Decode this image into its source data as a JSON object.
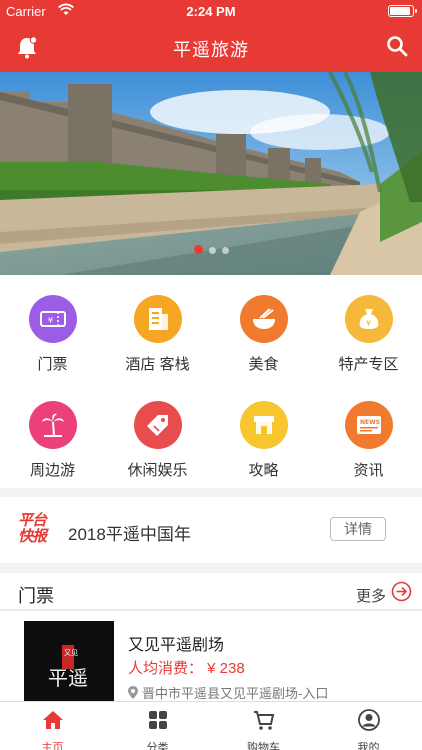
{
  "status": {
    "carrier": "Carrier",
    "time": "2:24 PM"
  },
  "nav": {
    "title": "平遥旅游",
    "bell_icon": "bell-icon",
    "search_icon": "search-icon"
  },
  "banner": {
    "page_count": 3,
    "active_index": 0
  },
  "categories": [
    {
      "label": "门票",
      "icon": "ticket-icon",
      "color": "#9b5de5"
    },
    {
      "label": "酒店 客栈",
      "icon": "hotel-icon",
      "color": "#f5a623"
    },
    {
      "label": "美食",
      "icon": "bowl-icon",
      "color": "#f07a2e"
    },
    {
      "label": "特产专区",
      "icon": "bag-icon",
      "color": "#f6b83a"
    },
    {
      "label": "周边游",
      "icon": "palm-tree-icon",
      "color": "#ec407a"
    },
    {
      "label": "休闲娱乐",
      "icon": "tag-icon",
      "color": "#e84d4d"
    },
    {
      "label": "攻略",
      "icon": "guide-icon",
      "color": "#f7c52e"
    },
    {
      "label": "资讯",
      "icon": "news-icon",
      "color": "#f07a2e"
    }
  ],
  "news": {
    "logo_line1": "平台",
    "logo_line2": "快报",
    "text": "2018平遥中国年",
    "button": "详情"
  },
  "tickets_section": {
    "title": "门票",
    "more": "更多"
  },
  "ticket_item": {
    "name": "又见平遥剧场",
    "price": "人均消费： ¥ 238",
    "address": "晋中市平遥县又见平遥剧场-入口",
    "thumb_text": "平遥",
    "thumb_seal": "又见"
  },
  "tabs": [
    {
      "label": "主页",
      "icon": "home-icon",
      "active": true
    },
    {
      "label": "分类",
      "icon": "category-icon",
      "active": false
    },
    {
      "label": "购物车",
      "icon": "cart-icon",
      "active": false
    },
    {
      "label": "我的",
      "icon": "profile-icon",
      "active": false
    }
  ],
  "colors": {
    "brand": "#e83a35"
  }
}
